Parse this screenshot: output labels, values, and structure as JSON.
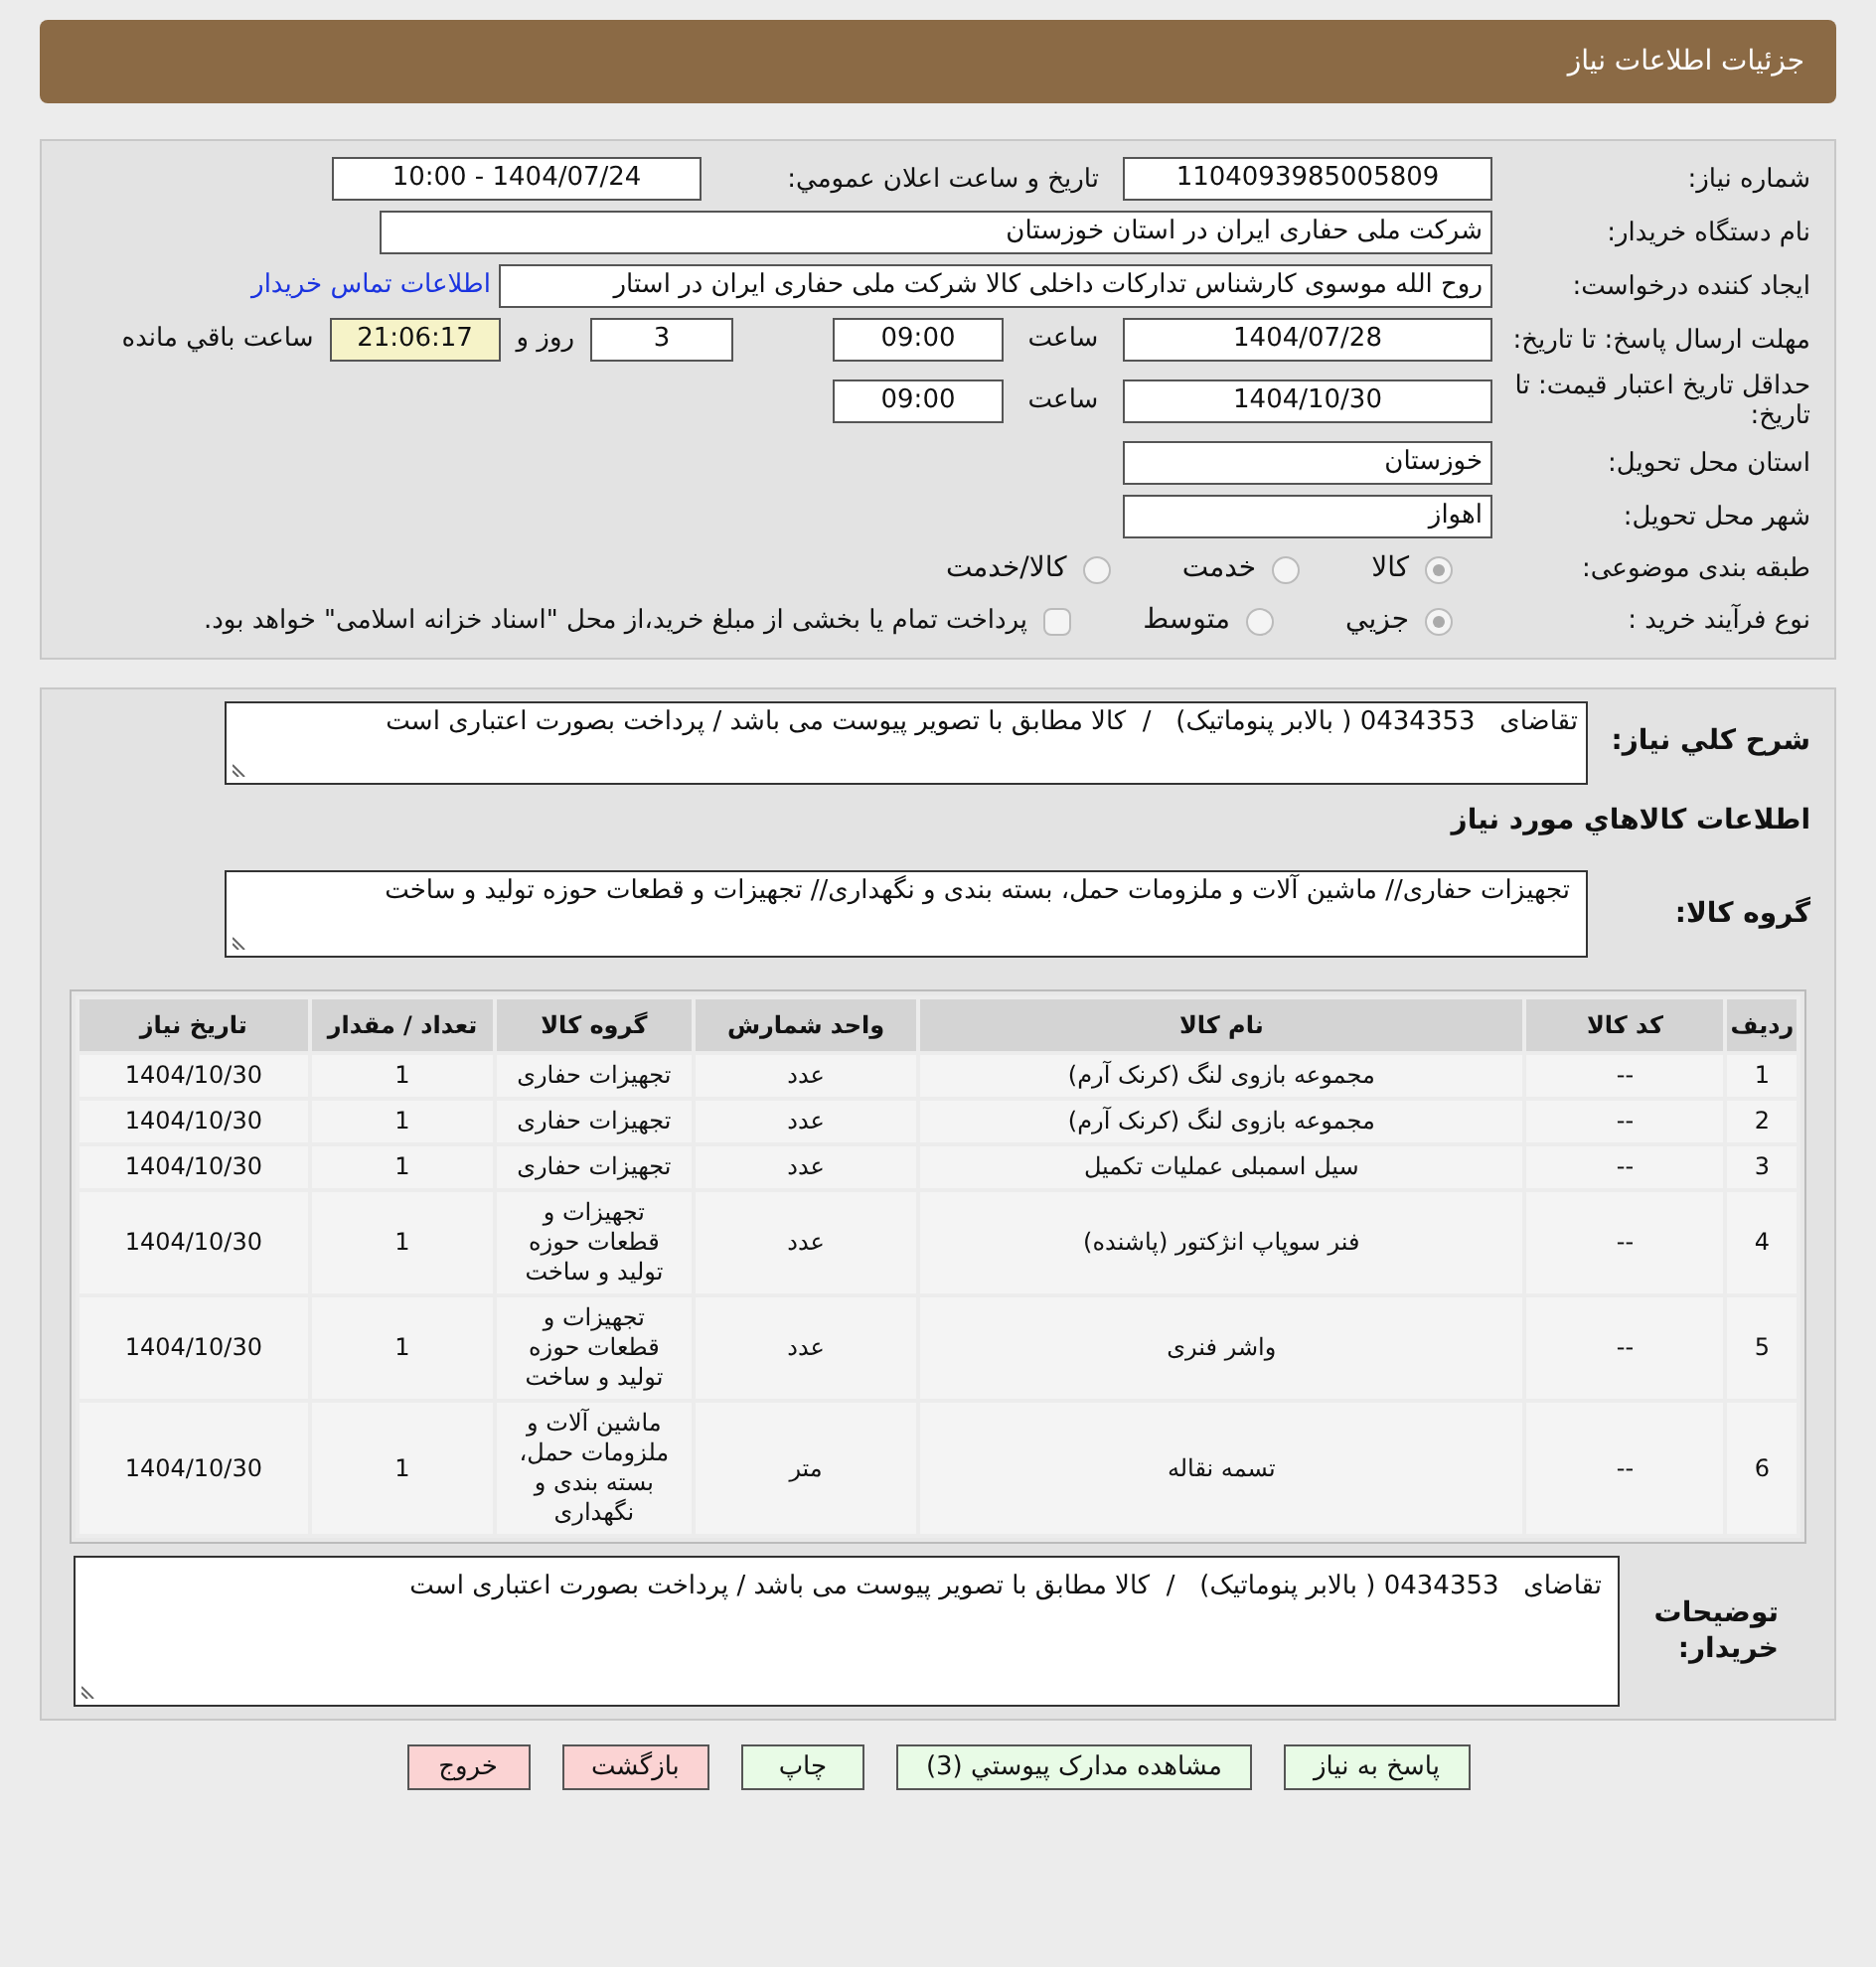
{
  "header": {
    "title": "جزئیات اطلاعات نیاز"
  },
  "details": {
    "need_number": {
      "label": "شماره نیاز:",
      "value": "1104093985005809"
    },
    "announce": {
      "label": "تاریخ و ساعت اعلان عمومي:",
      "value": "1404/07/24 - 10:00"
    },
    "buyer": {
      "label": "نام دستگاه خریدار:",
      "value": "شرکت ملی حفاری ایران در استان خوزستان"
    },
    "creator": {
      "label": "ایجاد کننده درخواست:",
      "value": "روح الله موسوی کارشناس تدارکات داخلی کالا شرکت ملی حفاری ایران در استار",
      "link": "اطلاعات تماس خریدار"
    },
    "deadline": {
      "label": "مهلت ارسال پاسخ: تا تاریخ:",
      "date": "1404/07/28",
      "time_label": "ساعت",
      "time": "09:00",
      "days": "3",
      "days_label": "روز و",
      "remaining": "21:06:17",
      "remaining_label": "ساعت باقي مانده"
    },
    "validity": {
      "label": "حداقل تاریخ اعتبار قیمت: تا تاریخ:",
      "date": "1404/10/30",
      "time_label": "ساعت",
      "time": "09:00"
    },
    "province": {
      "label": "استان محل تحویل:",
      "value": "خوزستان"
    },
    "city": {
      "label": "شهر محل تحویل:",
      "value": "اهواز"
    },
    "category": {
      "label": "طبقه بندی موضوعی:",
      "options": [
        {
          "label": "کالا",
          "selected": true
        },
        {
          "label": "خدمت",
          "selected": false
        },
        {
          "label": "کالا/خدمت",
          "selected": false
        }
      ]
    },
    "process": {
      "label": "نوع فرآیند خرید :",
      "options": [
        {
          "label": "جزيي",
          "selected": true
        },
        {
          "label": "متوسط",
          "selected": false
        }
      ],
      "payment": {
        "checked": false,
        "label": "پرداخت تمام یا بخشی از مبلغ خرید،از محل \"اسناد خزانه اسلامی\" خواهد بود."
      }
    }
  },
  "summary": {
    "label": "شرح کلي نیاز:",
    "value": "تقاضای   0434353 ( بالابر پنوماتیک)   /  کالا مطابق با تصویر پیوست می باشد / پرداخت بصورت اعتباری است"
  },
  "goods_heading": "اطلاعات کالاهاي مورد نیاز",
  "goods_group": {
    "label": "گروه کالا:",
    "value": "تجهیزات حفاری// ماشین آلات و ملزومات حمل، بسته بندی و نگهداری// تجهیزات و قطعات حوزه تولید و ساخت"
  },
  "table": {
    "columns": [
      "ردیف",
      "کد کالا",
      "نام کالا",
      "واحد شمارش",
      "گروه کالا",
      "تعداد / مقدار",
      "تاریخ نیاز"
    ],
    "rows": [
      [
        "1",
        "--",
        "مجموعه بازوی لنگ (کرنک آرم)",
        "عدد",
        "تجهیزات حفاری",
        "1",
        "1404/10/30"
      ],
      [
        "2",
        "--",
        "مجموعه بازوی لنگ (کرنک آرم)",
        "عدد",
        "تجهیزات حفاری",
        "1",
        "1404/10/30"
      ],
      [
        "3",
        "--",
        "سیل اسمبلی عملیات تکمیل",
        "عدد",
        "تجهیزات حفاری",
        "1",
        "1404/10/30"
      ],
      [
        "4",
        "--",
        "فنر سوپاپ انژکتور (پاشنده)",
        "عدد",
        "تجهیزات و قطعات حوزه تولید و ساخت",
        "1",
        "1404/10/30"
      ],
      [
        "5",
        "--",
        "واشر فنری",
        "عدد",
        "تجهیزات و قطعات حوزه تولید و ساخت",
        "1",
        "1404/10/30"
      ],
      [
        "6",
        "--",
        "تسمه نقاله",
        "متر",
        "ماشین آلات و ملزومات حمل، بسته بندی و نگهداری",
        "1",
        "1404/10/30"
      ]
    ]
  },
  "buyer_notes": {
    "label": "توضیحات خریدار:",
    "value": "تقاضای   0434353 ( بالابر پنوماتیک)   /  کالا مطابق با تصویر پیوست می باشد / پرداخت بصورت اعتباری است"
  },
  "buttons": [
    {
      "label": "پاسخ به نیاز",
      "kind": "normal"
    },
    {
      "label": "مشاهده مدارک پیوستي (3)",
      "kind": "normal"
    },
    {
      "label": "چاپ",
      "kind": "normal"
    },
    {
      "label": "بازگشت",
      "kind": "danger"
    },
    {
      "label": "خروج",
      "kind": "danger"
    }
  ]
}
